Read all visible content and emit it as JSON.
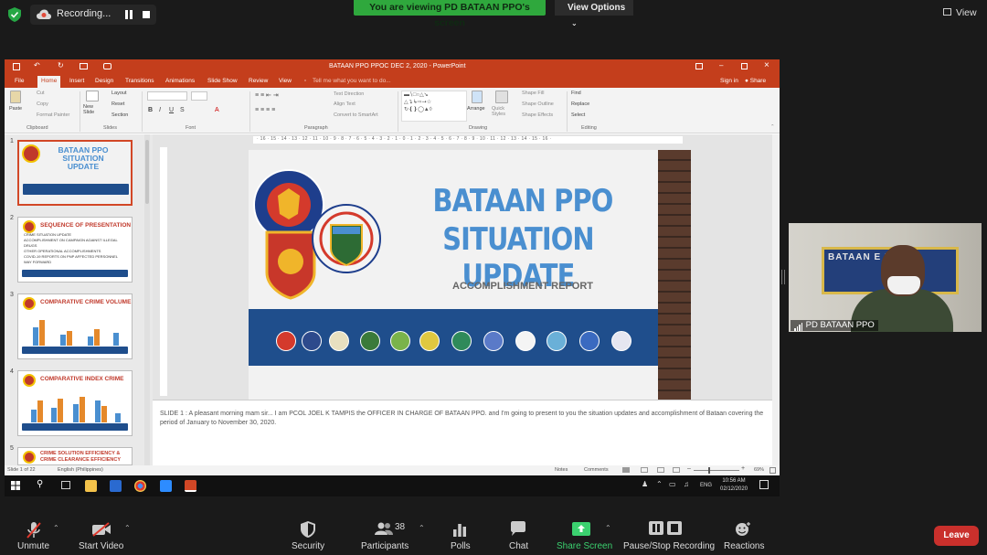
{
  "zoom_top": {
    "recording_label": "Recording...",
    "viewing_banner": "You are viewing PD BATAAN PPO's screen",
    "view_options": "View Options",
    "view_button": "View"
  },
  "ppt": {
    "window_title": "BATAAN PPO PPOC DEC 2, 2020 - PowerPoint",
    "tell_me": "Tell me what you want to do...",
    "sign_in": "Sign in",
    "share": "Share",
    "tabs": [
      "File",
      "Home",
      "Insert",
      "Design",
      "Transitions",
      "Animations",
      "Slide Show",
      "Review",
      "View"
    ],
    "ribbon": {
      "paste": "Paste",
      "cut": "Cut",
      "copy": "Copy",
      "format_painter": "Format Painter",
      "clipboard": "Clipboard",
      "new_slide": "New Slide",
      "layout": "Layout",
      "reset": "Reset",
      "section": "Section",
      "slides": "Slides",
      "font": "Font",
      "text_direction": "Text Direction",
      "align_text": "Align Text",
      "convert_smartart": "Convert to SmartArt",
      "paragraph": "Paragraph",
      "arrange": "Arrange",
      "quick_styles": "Quick Styles",
      "shape_fill": "Shape Fill",
      "shape_outline": "Shape Outline",
      "shape_effects": "Shape Effects",
      "drawing": "Drawing",
      "find": "Find",
      "replace": "Replace",
      "select": "Select",
      "editing": "Editing"
    },
    "thumbnails": [
      {
        "num": "1",
        "title": "BATAAN PPO SITUATION UPDATE"
      },
      {
        "num": "2",
        "title": "SEQUENCE OF PRESENTATION",
        "items": [
          "CRIME SITUATION UPDATE",
          "ACCOMPLISHMENT ON CAMPAIGN AGAINST ILLEGAL DRUGS",
          "OTHER OPERATIONAL ACCOMPLISHMENTS",
          "COVID-19 REPORTS ON PNP AFFECTED PERSONNEL",
          "WAY FORWARD"
        ]
      },
      {
        "num": "3",
        "title": "COMPARATIVE CRIME VOLUME"
      },
      {
        "num": "4",
        "title": "COMPARATIVE INDEX CRIME"
      },
      {
        "num": "5",
        "title": "CRIME SOLUTION EFFICIENCY & CRIME CLEARANCE EFFICIENCY"
      }
    ],
    "ruler_top": "· 16 · 15 · 14 · 13 · 12 · 11 · 10 · 9 · 8 · 7 · 6 · 5 · 4 · 3 · 2 · 1 · 0 · 1 · 2 · 3 · 4 · 5 · 6 · 7 · 8 · 9 · 10 · 11 · 12 · 13 · 14 · 15 · 16 ·",
    "slide": {
      "title_line1": "BATAAN PPO",
      "title_line2": "SITUATION UPDATE",
      "subtitle": "ACCOMPLISHMENT REPORT",
      "seal_a_text": "POLICE REGIONAL OFFICE",
      "seal_b_text": "PHILIPPINE NATIONAL POLICE",
      "seal_b_bottom": "BATAAN PPO PROV"
    },
    "notes": "SLIDE 1 : A pleasant morning mam sir... I am PCOL JOEL K TAMPIS the OFFICER IN CHARGE OF BATAAN PPO. and I'm going to present to you the situation updates and accomplishment of Bataan covering the period of January to November 30, 2020.",
    "status": {
      "slide_of": "Slide 1 of 22",
      "language": "English (Philippines)",
      "notes_btn": "Notes",
      "comments_btn": "Comments",
      "zoom": "69%"
    }
  },
  "taskbar": {
    "time": "10:56 AM",
    "date": "02/12/2020",
    "lang": "ENG"
  },
  "video": {
    "participant_name": "PD BATAAN PPO",
    "board_text": "BATAAN   E PROVI"
  },
  "zoom_bottom": {
    "unmute": "Unmute",
    "start_video": "Start Video",
    "security": "Security",
    "participants": "Participants",
    "participants_count": "38",
    "polls": "Polls",
    "chat": "Chat",
    "share_screen": "Share Screen",
    "pause_stop": "Pause/Stop Recording",
    "reactions": "Reactions",
    "leave": "Leave"
  },
  "colors": {
    "ppt_accent": "#c43e1c",
    "zoom_green": "#2fa83d",
    "slide_blue": "#4a8fd0",
    "leave_red": "#c9302c"
  }
}
